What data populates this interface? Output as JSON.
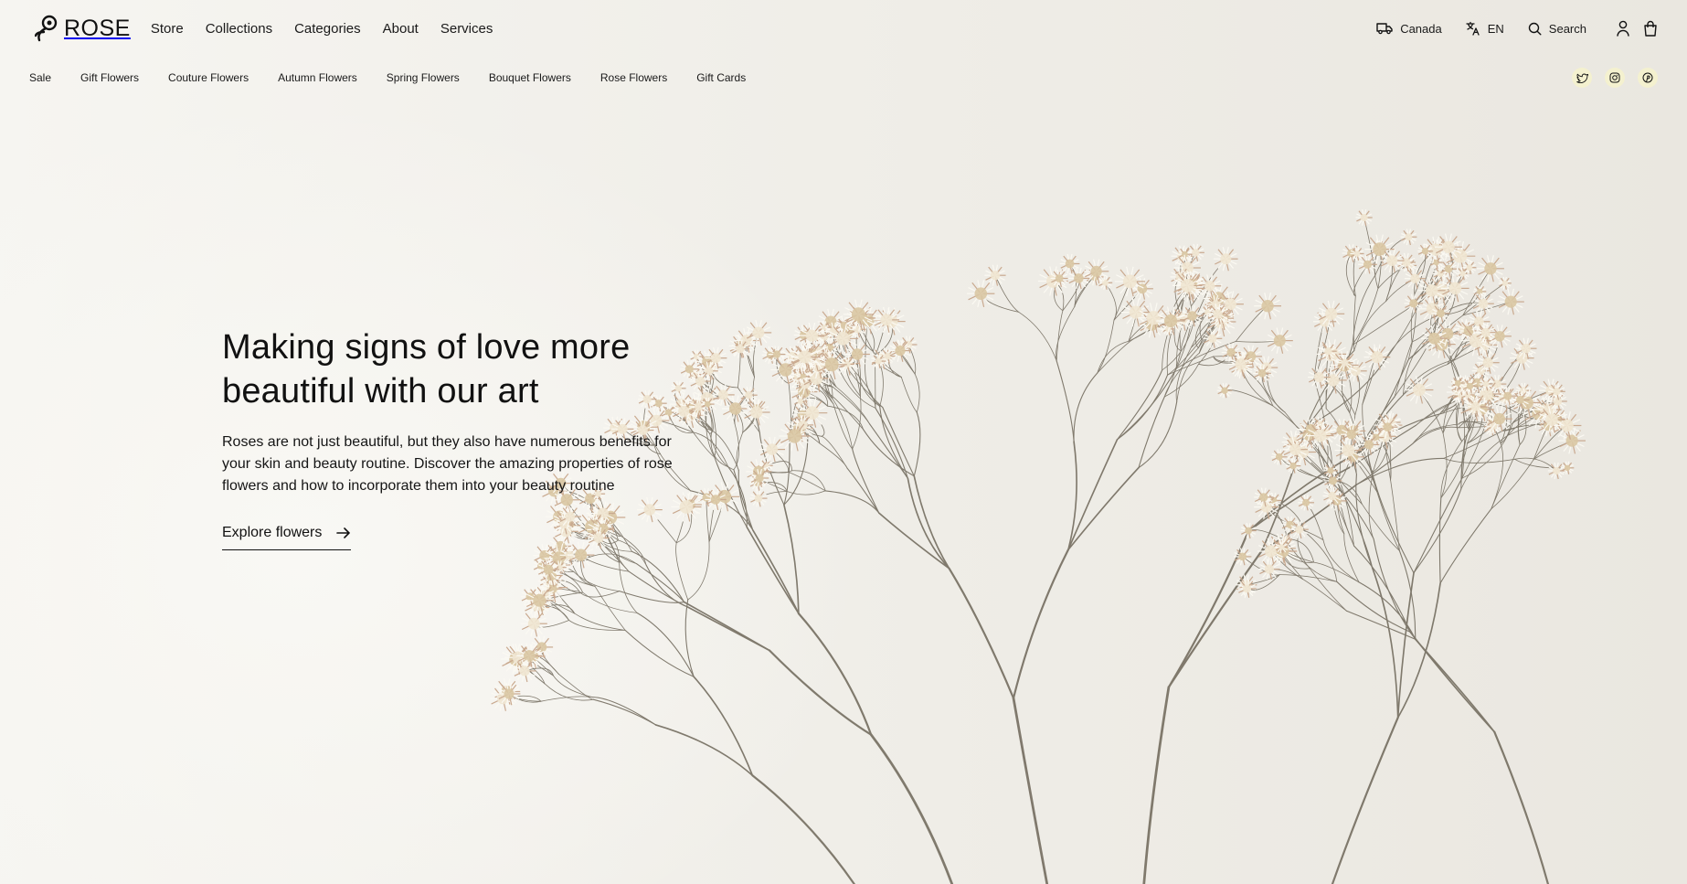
{
  "brand": {
    "name": "ROSE"
  },
  "main_nav": [
    {
      "label": "Store"
    },
    {
      "label": "Collections"
    },
    {
      "label": "Categories"
    },
    {
      "label": "About"
    },
    {
      "label": "Services"
    }
  ],
  "utilities": {
    "region": {
      "label": "Canada",
      "icon": "truck-icon"
    },
    "language": {
      "label": "EN",
      "icon": "translate-icon"
    },
    "search": {
      "label": "Search",
      "icon": "search-icon"
    },
    "account_icon": "user-icon",
    "cart_icon": "bag-icon"
  },
  "category_nav": [
    {
      "label": "Sale"
    },
    {
      "label": "Gift Flowers"
    },
    {
      "label": "Couture Flowers"
    },
    {
      "label": "Autumn Flowers"
    },
    {
      "label": "Spring Flowers"
    },
    {
      "label": "Bouquet Flowers"
    },
    {
      "label": "Rose Flowers"
    },
    {
      "label": "Gift Cards"
    }
  ],
  "social": [
    {
      "icon": "twitter-icon"
    },
    {
      "icon": "instagram-icon"
    },
    {
      "icon": "pinterest-icon"
    }
  ],
  "hero": {
    "title": "Making signs of love more beautiful with our art",
    "description": "Roses are not just beautiful, but they also have numerous benefits for your skin and beauty routine. Discover the amazing properties of rose flowers and how to incorporate them into your beauty routine",
    "cta_label": "Explore flowers",
    "cta_icon": "arrow-right-icon"
  },
  "colors": {
    "background": "#f3f1ec",
    "text": "#111111",
    "social_bg": "#f4f1cf"
  }
}
